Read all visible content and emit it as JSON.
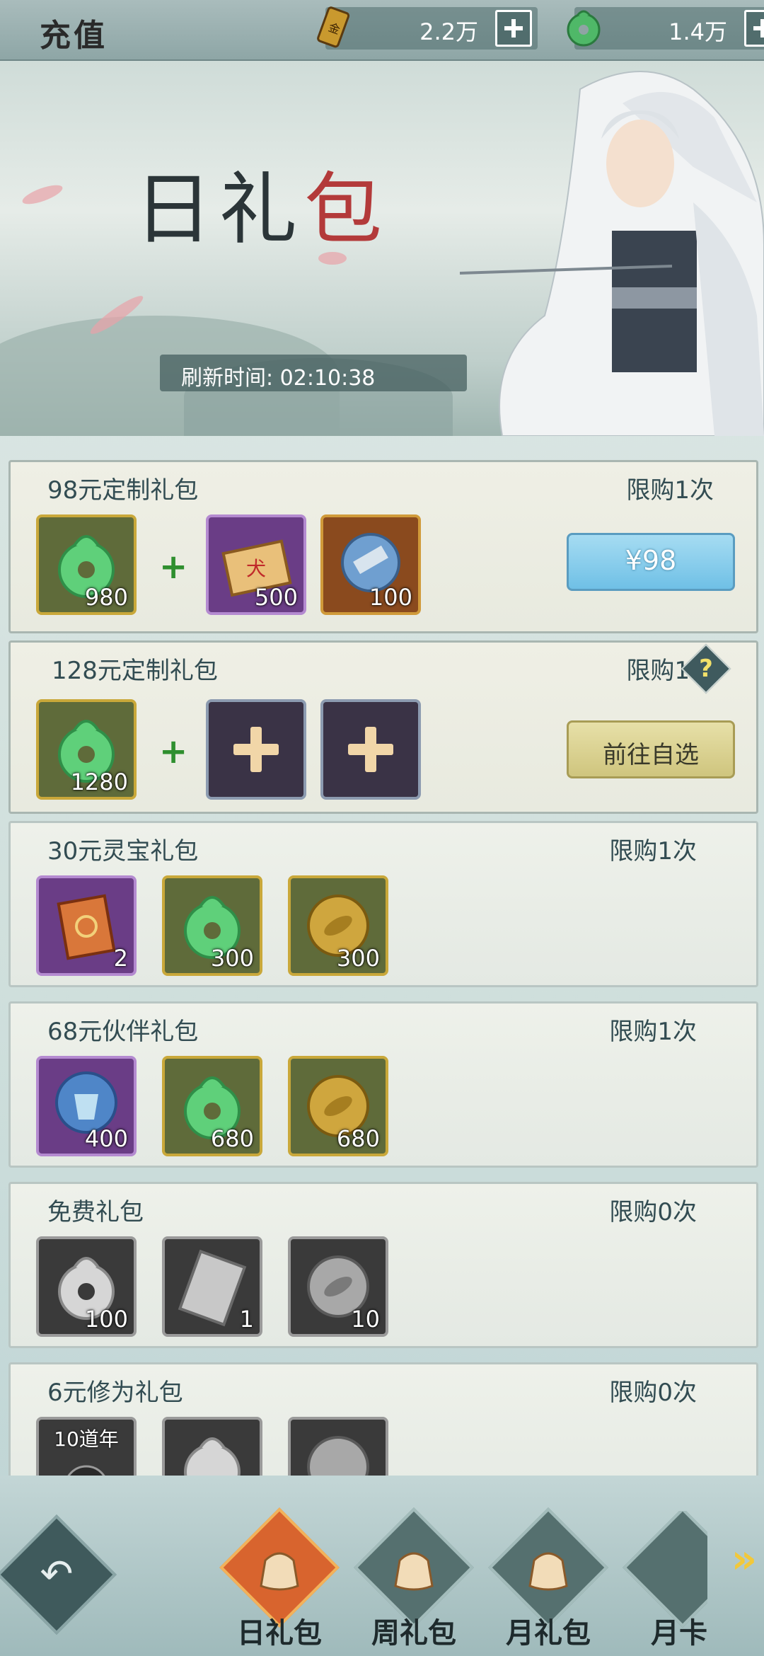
{
  "header": {
    "title": "充值",
    "gold": "2.2万",
    "jade": "1.4万"
  },
  "banner": {
    "title_main": "日礼",
    "title_seal": "包",
    "refresh_label": "刷新时间:",
    "refresh_time": "02:10:38"
  },
  "packs": [
    {
      "name": "98元定制礼包",
      "limit": "限购1次",
      "button": "¥98",
      "items": [
        {
          "qty": "980"
        },
        {
          "qty": "500"
        },
        {
          "qty": "100"
        }
      ]
    },
    {
      "name": "128元定制礼包",
      "limit": "限购1次",
      "button": "前往自选",
      "items": [
        {
          "qty": "1280"
        }
      ]
    },
    {
      "name": "30元灵宝礼包",
      "limit": "限购1次",
      "items": [
        {
          "qty": "2"
        },
        {
          "qty": "300"
        },
        {
          "qty": "300"
        }
      ]
    },
    {
      "name": "68元伙伴礼包",
      "limit": "限购1次",
      "items": [
        {
          "qty": "400"
        },
        {
          "qty": "680"
        },
        {
          "qty": "680"
        }
      ]
    },
    {
      "name": "免费礼包",
      "limit": "限购0次",
      "items": [
        {
          "qty": "100"
        },
        {
          "qty": "1"
        },
        {
          "qty": "10"
        }
      ]
    },
    {
      "name": "6元修为礼包",
      "limit": "限购0次",
      "items": [
        {
          "label": "10道年"
        }
      ]
    }
  ],
  "tabs": [
    {
      "label": "日礼包"
    },
    {
      "label": "周礼包"
    },
    {
      "label": "月礼包"
    },
    {
      "label": "月卡"
    }
  ],
  "colors": {
    "accent_active": "#d8642e",
    "price_button": "#6fc0e6",
    "choose_button": "#cfc57e"
  }
}
